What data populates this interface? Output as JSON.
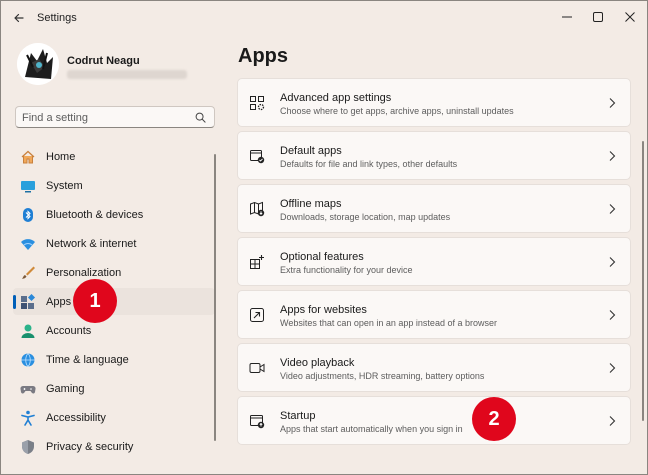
{
  "window": {
    "title": "Settings"
  },
  "profile": {
    "name": "Codrut Neagu"
  },
  "search": {
    "placeholder": "Find a setting"
  },
  "nav": {
    "items": [
      {
        "label": "Home",
        "icon": "home-icon"
      },
      {
        "label": "System",
        "icon": "system-icon"
      },
      {
        "label": "Bluetooth & devices",
        "icon": "bluetooth-icon"
      },
      {
        "label": "Network & internet",
        "icon": "wifi-icon"
      },
      {
        "label": "Personalization",
        "icon": "brush-icon"
      },
      {
        "label": "Apps",
        "icon": "apps-icon",
        "selected": true
      },
      {
        "label": "Accounts",
        "icon": "person-icon"
      },
      {
        "label": "Time & language",
        "icon": "globe-icon"
      },
      {
        "label": "Gaming",
        "icon": "gamepad-icon"
      },
      {
        "label": "Accessibility",
        "icon": "accessibility-icon"
      },
      {
        "label": "Privacy & security",
        "icon": "shield-icon"
      }
    ]
  },
  "main": {
    "title": "Apps",
    "cards": [
      {
        "title": "Advanced app settings",
        "subtitle": "Choose where to get apps, archive apps, uninstall updates",
        "icon": "app-settings-icon"
      },
      {
        "title": "Default apps",
        "subtitle": "Defaults for file and link types, other defaults",
        "icon": "default-apps-icon"
      },
      {
        "title": "Offline maps",
        "subtitle": "Downloads, storage location, map updates",
        "icon": "map-icon"
      },
      {
        "title": "Optional features",
        "subtitle": "Extra functionality for your device",
        "icon": "optional-features-icon"
      },
      {
        "title": "Apps for websites",
        "subtitle": "Websites that can open in an app instead of a browser",
        "icon": "open-in-app-icon"
      },
      {
        "title": "Video playback",
        "subtitle": "Video adjustments, HDR streaming, battery options",
        "icon": "video-icon"
      },
      {
        "title": "Startup",
        "subtitle": "Apps that start automatically when you sign in",
        "icon": "startup-icon"
      }
    ]
  },
  "badges": {
    "one": "1",
    "two": "2"
  },
  "colors": {
    "accent": "#005fb8",
    "badge": "#e0061c",
    "background": "#f3ebe5"
  }
}
